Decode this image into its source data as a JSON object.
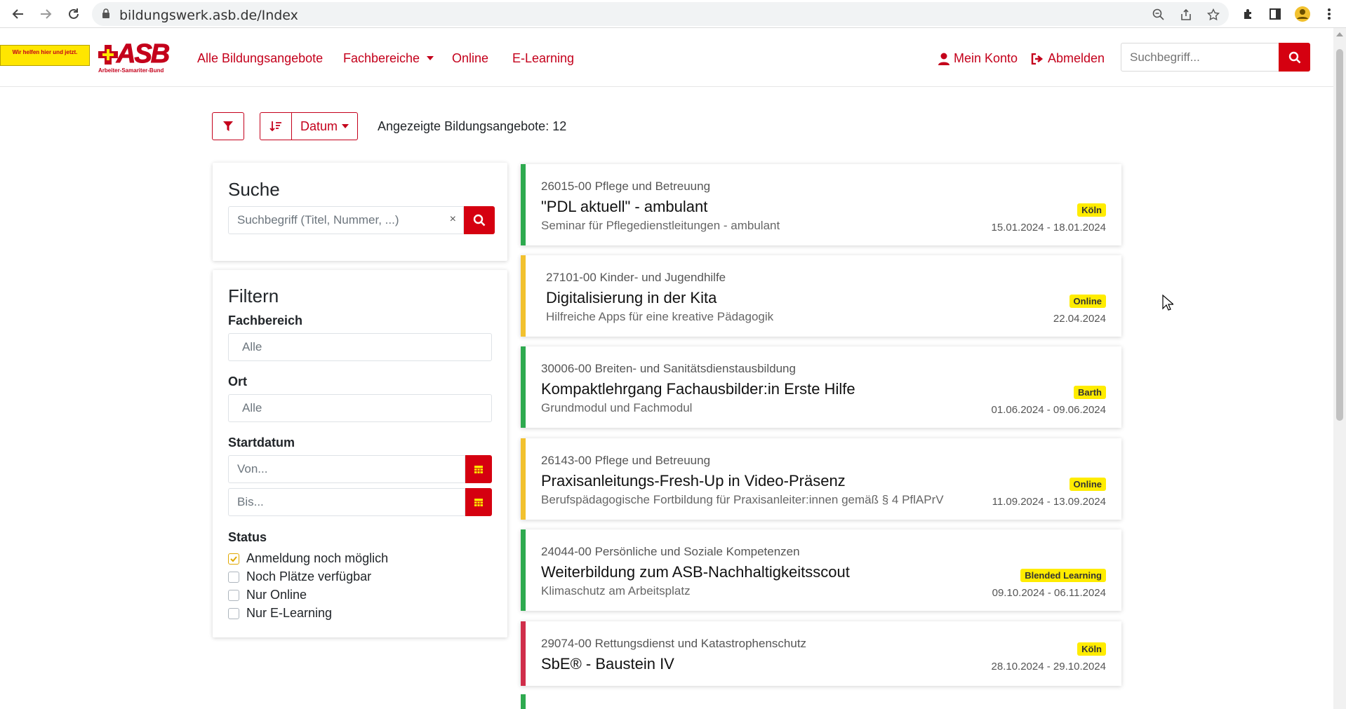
{
  "browser": {
    "url": "bildungswerk.asb.de/Index"
  },
  "header": {
    "logo_tagline": "Wir helfen hier und jetzt.",
    "logo_text": "ASB",
    "logo_sub": "Arbeiter-Samariter-Bund",
    "nav": {
      "all": "Alle Bildungsangebote",
      "areas": "Fachbereiche",
      "online": "Online",
      "elearning": "E-Learning"
    },
    "account": "Mein Konto",
    "logout": "Abmelden",
    "search_placeholder": "Suchbegriff..."
  },
  "toolbar": {
    "sort_label": "Datum",
    "count_text": "Angezeigte Bildungsangebote: 12"
  },
  "search_card": {
    "heading": "Suche",
    "placeholder": "Suchbegriff (Titel, Nummer, ...)",
    "clear": "×"
  },
  "filter_card": {
    "heading": "Filtern",
    "area_label": "Fachbereich",
    "area_value": "Alle",
    "place_label": "Ort",
    "place_value": "Alle",
    "start_label": "Startdatum",
    "from_placeholder": "Von...",
    "to_placeholder": "Bis...",
    "status_label": "Status",
    "status": [
      {
        "label": "Anmeldung noch möglich",
        "checked": true
      },
      {
        "label": "Noch Plätze verfügbar",
        "checked": false
      },
      {
        "label": "Nur Online",
        "checked": false
      },
      {
        "label": "Nur E-Learning",
        "checked": false
      }
    ]
  },
  "courses": [
    {
      "num": "26015-00 Pflege und Betreuung",
      "title": "\"PDL aktuell\" - ambulant",
      "sub": "Seminar für Pflegedienstleitungen - ambulant",
      "badge": "Köln",
      "date": "15.01.2024 - 18.01.2024",
      "color": "#2eaa4f"
    },
    {
      "num": "27101-00 Kinder- und Jugendhilfe",
      "title": "Digitalisierung in der Kita",
      "sub": "Hilfreiche Apps für eine kreative Pädagogik",
      "badge": "Online",
      "date": "22.04.2024",
      "color": "#f2c12e"
    },
    {
      "num": "30006-00 Breiten- und Sanitätsdienstausbildung",
      "title": "Kompaktlehrgang Fachausbilder:in Erste Hilfe",
      "sub": "Grundmodul und Fachmodul",
      "badge": "Barth",
      "date": "01.06.2024 - 09.06.2024",
      "color": "#2eaa4f"
    },
    {
      "num": "26143-00 Pflege und Betreuung",
      "title": "Praxisanleitungs-Fresh-Up in Video-Präsenz",
      "sub": "Berufspädagogische Fortbildung für Praxisanleiter:innen gemäß § 4 PflAPrV",
      "badge": "Online",
      "date": "11.09.2024 - 13.09.2024",
      "color": "#f2c12e"
    },
    {
      "num": "24044-00 Persönliche und Soziale Kompetenzen",
      "title": "Weiterbildung zum ASB-Nachhaltigkeitsscout",
      "sub": "Klimaschutz am Arbeitsplatz",
      "badge": "Blended Learning",
      "date": "09.10.2024 - 06.11.2024",
      "color": "#2eaa4f"
    },
    {
      "num": "29074-00 Rettungsdienst und Katastrophenschutz",
      "title": "SbE® - Baustein IV",
      "sub": "",
      "badge": "Köln",
      "date": "28.10.2024 - 29.10.2024",
      "color": "#d02e4a"
    }
  ],
  "colors": {
    "brand_red": "#c4001b",
    "button_red": "#d50010",
    "badge_yellow": "#ffec00"
  }
}
